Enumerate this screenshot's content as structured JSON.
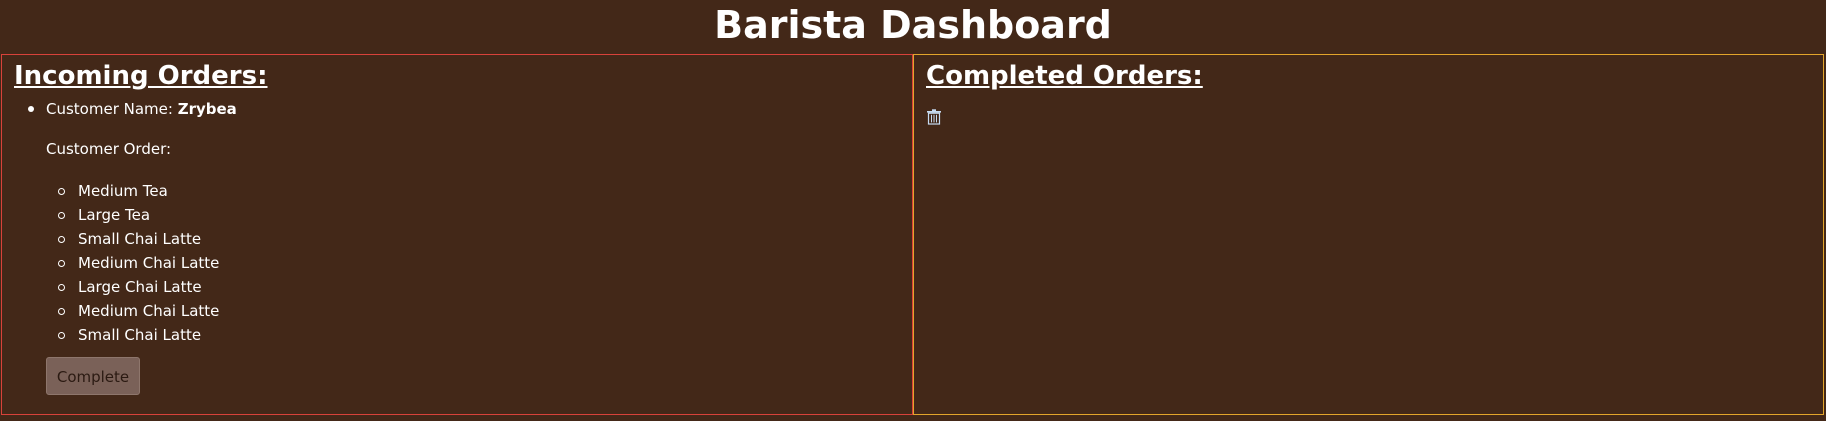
{
  "header": {
    "title": "Barista Dashboard"
  },
  "incoming": {
    "heading": "Incoming Orders:",
    "orders": [
      {
        "customer_label": "Customer Name:",
        "customer_name": "Zrybea",
        "order_label": "Customer Order:",
        "items": [
          "Medium Tea",
          "Large Tea",
          "Small Chai Latte",
          "Medium Chai Latte",
          "Large Chai Latte",
          "Medium Chai Latte",
          "Small Chai Latte"
        ],
        "complete_label": "Complete"
      }
    ]
  },
  "completed": {
    "heading": "Completed Orders:",
    "clear_icon": "trash-icon"
  },
  "colors": {
    "background": "#432818",
    "text": "#ffffff",
    "incoming_border": "#d9423a",
    "completed_border": "#e3a52b",
    "button_bg": "#7a6158"
  }
}
